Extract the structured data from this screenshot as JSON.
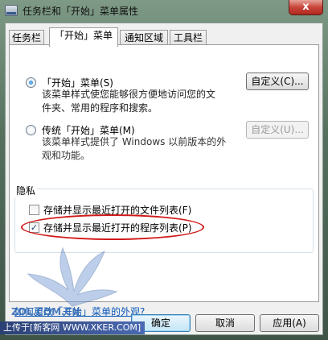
{
  "window": {
    "title": "任务栏和「开始」菜单属性",
    "close_label": "x"
  },
  "tabs": [
    {
      "label": "任务栏"
    },
    {
      "label": "「开始」菜单"
    },
    {
      "label": "通知区域"
    },
    {
      "label": "工具栏"
    }
  ],
  "start_menu": {
    "option_label": "「开始」菜单(S)",
    "desc_line1": "该菜单样式使您能够很方便地访问您的文",
    "desc_line2": "件夹、常用的程序和搜索。",
    "customize_label": "自定义(C)..."
  },
  "classic_menu": {
    "option_label": "传统「开始」菜单(M)",
    "desc_line1": "该菜单样式提供了 Windows 以前版本的外",
    "desc_line2": "观和功能。",
    "customize_label": "自定义(U)..."
  },
  "privacy": {
    "group_title": "隐私",
    "store_files_label": "存储并显示最近打开的文件列表(F)",
    "store_programs_label": "存储并显示最近打开的程序列表(P)",
    "store_files_checked": false,
    "store_programs_checked": true
  },
  "help_link": "如何更改「开始」菜单的外观?",
  "buttons": {
    "ok": "确定",
    "cancel": "取消",
    "apply": "应用(A)"
  },
  "overlay": {
    "watermark_text": "ZOL.COM.CN",
    "footer_text": "上传于[新客网 WWW.XKER.COM]"
  },
  "colors": {
    "highlight_ellipse": "#d11a1a",
    "link": "#0b58b8"
  }
}
